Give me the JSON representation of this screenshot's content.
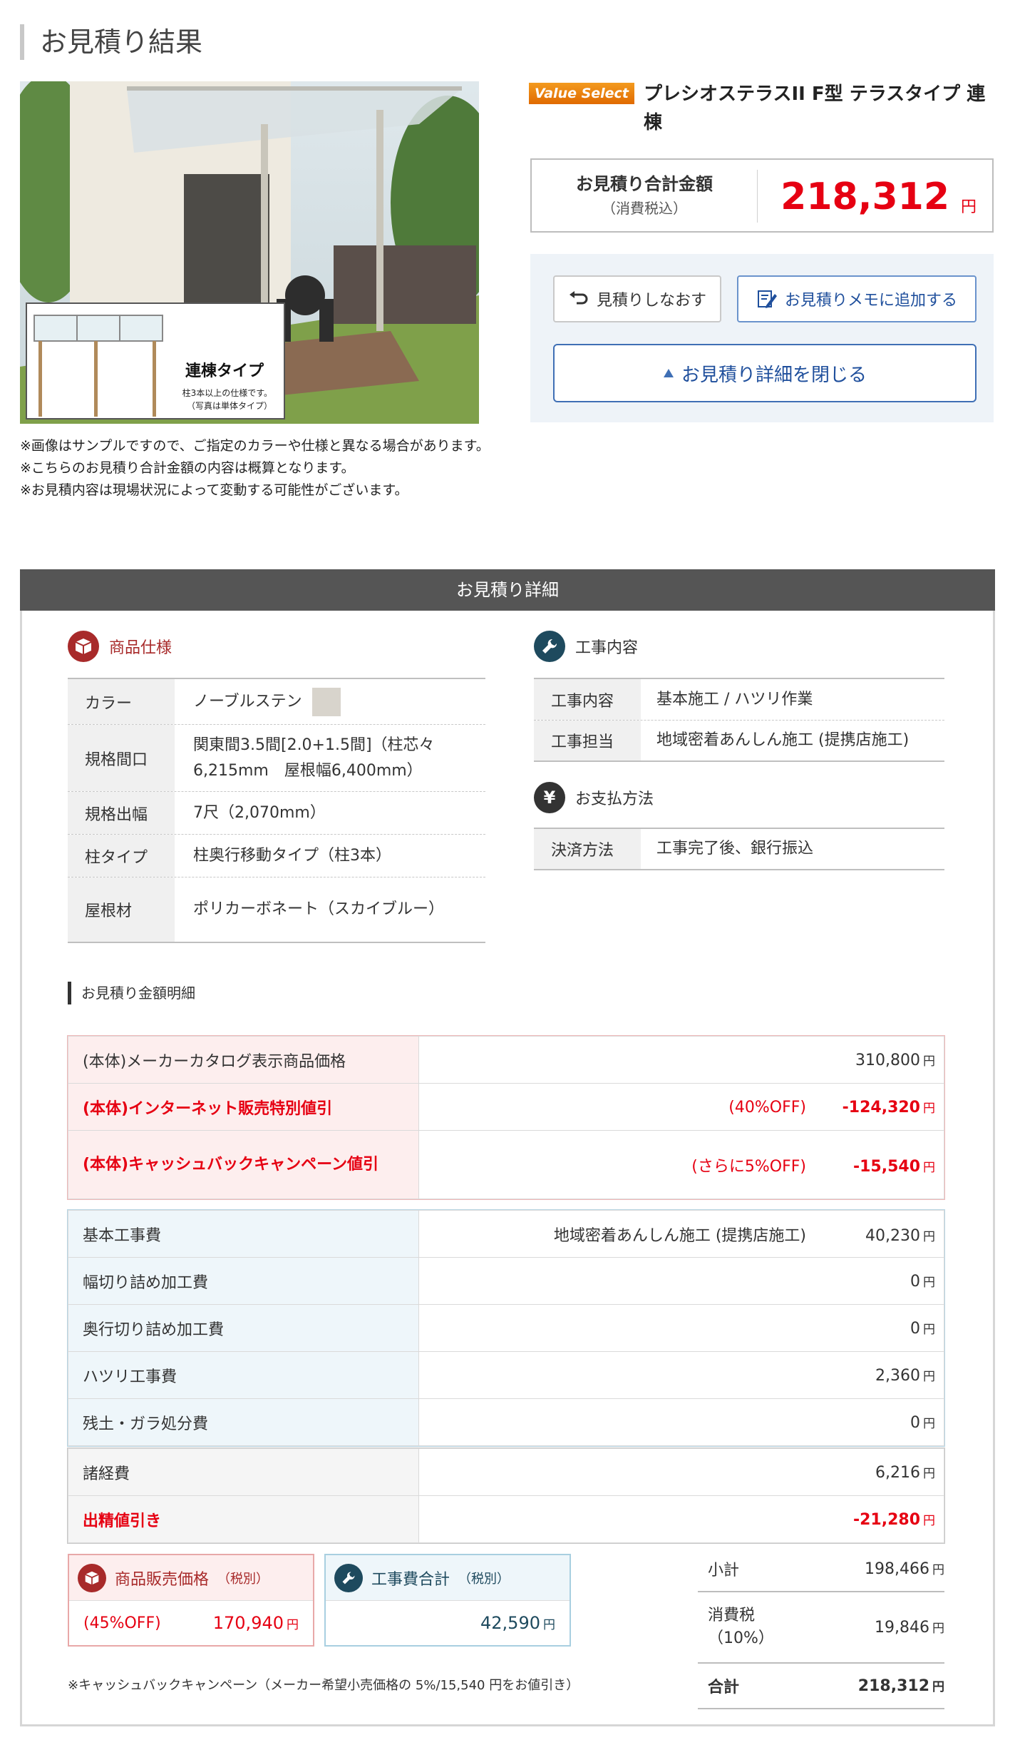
{
  "page": {
    "title": "お見積り結果"
  },
  "image": {
    "inset_title": "連棟タイプ",
    "inset_sub": "柱3本以上の仕様です。\n（写真は単体タイプ）"
  },
  "notes": [
    "※画像はサンプルですので、ご指定のカラーや仕様と異なる場合があります。",
    "※こちらのお見積り合計金額の内容は概算となります。",
    "※お見積内容は現場状況によって変動する可能性がございます。"
  ],
  "product": {
    "badge": "Value Select",
    "name": "プレシオステラスII F型 テラスタイプ 連棟"
  },
  "total": {
    "label": "お見積り合計金額",
    "sub": "（消費税込）",
    "value": "218,312",
    "unit": "円"
  },
  "actions": {
    "redo": "見積りしなおす",
    "memo": "お見積りメモに追加する",
    "close": "お見積り詳細を閉じる"
  },
  "detail": {
    "header": "お見積り詳細",
    "spec_title": "商品仕様",
    "spec": [
      {
        "label": "カラー",
        "value": "ノーブルステン"
      },
      {
        "label": "規格間口",
        "value": "関東間3.5間[2.0+1.5間]（柱芯々6,215mm　屋根幅6,400mm）"
      },
      {
        "label": "規格出幅",
        "value": "7尺（2,070mm）"
      },
      {
        "label": "柱タイプ",
        "value": "柱奥行移動タイプ（柱3本）"
      },
      {
        "label": "屋根材",
        "value": "ポリカーボネート（スカイブルー）"
      }
    ],
    "swatch_color": "#d8d4cc",
    "work_title": "工事内容",
    "work": [
      {
        "label": "工事内容",
        "value": "基本施工 / ハツリ作業"
      },
      {
        "label": "工事担当",
        "value": "地域密着あんしん施工 (提携店施工)"
      }
    ],
    "pay_title": "お支払方法",
    "pay": [
      {
        "label": "決済方法",
        "value": "工事完了後、銀行振込"
      }
    ]
  },
  "breakdown": {
    "title": "お見積り金額明細",
    "product_rows": [
      {
        "label": "(本体)メーカーカタログ表示商品価格",
        "note": "",
        "amount": "310,800",
        "red": false
      },
      {
        "label": "(本体)インターネット販売特別値引",
        "note": "(40%OFF)",
        "amount": "-124,320",
        "red": true
      },
      {
        "label": "(本体)キャッシュバックキャンペーン値引",
        "note": "(さらに5%OFF)",
        "amount": "-15,540",
        "red": true
      }
    ],
    "work_rows": [
      {
        "label": "基本工事費",
        "note": "地域密着あんしん施工 (提携店施工)",
        "amount": "40,230"
      },
      {
        "label": "幅切り詰め加工費",
        "note": "",
        "amount": "0"
      },
      {
        "label": "奥行切り詰め加工費",
        "note": "",
        "amount": "0"
      },
      {
        "label": "ハツリ工事費",
        "note": "",
        "amount": "2,360"
      },
      {
        "label": "残土・ガラ処分費",
        "note": "",
        "amount": "0"
      }
    ],
    "misc_rows": [
      {
        "label": "諸経費",
        "amount": "6,216",
        "red": false
      },
      {
        "label": "出精値引き",
        "amount": "-21,280",
        "red": true
      }
    ],
    "unit": "円"
  },
  "summary": {
    "product_label": "商品販売価格",
    "product_tax": "（税別）",
    "product_off": "(45%OFF)",
    "product_value": "170,940",
    "work_label": "工事費合計",
    "work_tax": "（税別）",
    "work_value": "42,590",
    "subtotal_label": "小計",
    "subtotal": "198,466",
    "tax_label": "消費税\n（10%）",
    "tax": "19,846",
    "total_label": "合計",
    "total": "218,312",
    "footnote": "※キャッシュバックキャンペーン（メーカー希望小売価格の 5%/15,540 円をお値引き）"
  },
  "colors": {
    "red": "#e60012",
    "dark_red": "#a82a2a",
    "dark_teal": "#1e4a5e",
    "blue": "#1f4f9c"
  }
}
